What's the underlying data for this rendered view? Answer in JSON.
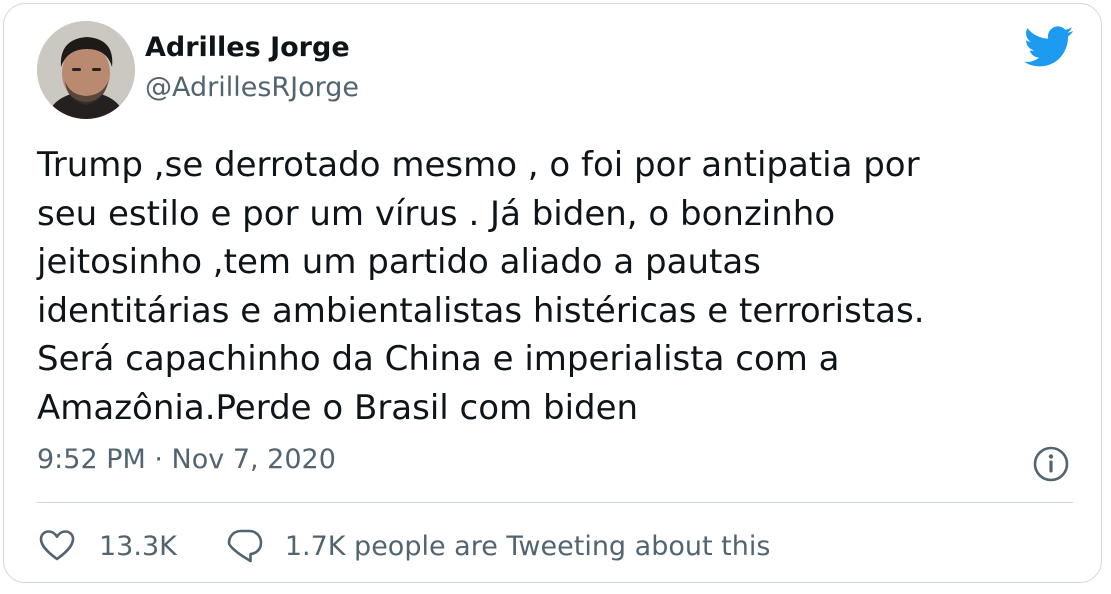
{
  "author": {
    "name": "Adrilles Jorge",
    "handle": "@AdrillesRJorge"
  },
  "tweet": {
    "text": "Trump ,se derrotado mesmo ,  o foi por antipatia por\nseu estilo e por um vírus . Já biden, o bonzinho\njeitosinho ,tem um partido aliado a pautas\nidentitárias e ambientalistas histéricas e terroristas.\nSerá capachinho da China e imperialista com a\nAmazônia.Perde o Brasil com biden",
    "timestamp": "9:52 PM · Nov 7, 2020"
  },
  "actions": {
    "likes": "13.3K",
    "replies_label": "1.7K people are Tweeting about this"
  },
  "icons": {
    "logo": "twitter-bird-icon",
    "info": "info-icon",
    "like": "heart-icon",
    "reply": "speech-bubble-icon"
  },
  "colors": {
    "brand": "#1d9bf0",
    "text": "#0f1419",
    "secondary": "#536471",
    "border": "#cfd9de"
  }
}
